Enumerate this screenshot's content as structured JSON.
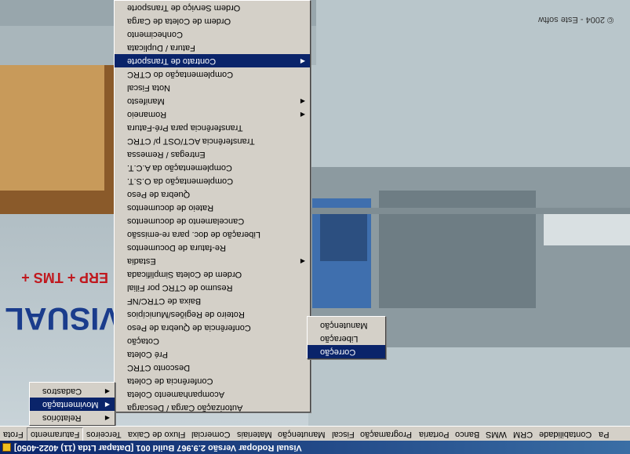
{
  "window": {
    "title": "Visual Rodopar Versão 2.9.967 Build 001 [Datapar Ltda (11) 4022-4050]"
  },
  "background": {
    "copyright": "© 2004 - Este softw",
    "brand_line": "ERP + TMS +",
    "brand_name": "VISUAL"
  },
  "menubar": {
    "items": [
      {
        "label": "Frota",
        "selected": false
      },
      {
        "label": "Faturamento",
        "selected": true
      },
      {
        "label": "Terceiros",
        "selected": false
      },
      {
        "label": "Fluxo de Caixa",
        "selected": false
      },
      {
        "label": "Comercial",
        "selected": false
      },
      {
        "label": "Materiais",
        "selected": false
      },
      {
        "label": "Manutenção",
        "selected": false
      },
      {
        "label": "Fiscal",
        "selected": false
      },
      {
        "label": "Programação",
        "selected": false
      },
      {
        "label": "Portaria",
        "selected": false
      },
      {
        "label": "Banco",
        "selected": false
      },
      {
        "label": "WMS",
        "selected": false
      },
      {
        "label": "CRM",
        "selected": false
      },
      {
        "label": "Contabilidade",
        "selected": false
      },
      {
        "label": "Pa",
        "selected": false
      }
    ]
  },
  "faturamento_menu": {
    "items": [
      {
        "label": "Cadastros",
        "submenu": true,
        "selected": false
      },
      {
        "label": "Movimentação",
        "submenu": true,
        "selected": true
      },
      {
        "label": "Relatórios",
        "submenu": true,
        "selected": false
      }
    ]
  },
  "movimentacao_menu": {
    "items": [
      {
        "label": "Ordem Serviço de Transporte",
        "submenu": false,
        "selected": false
      },
      {
        "label": "Ordem de Coleta de Carga",
        "submenu": false,
        "selected": false
      },
      {
        "label": "Conhecimento",
        "submenu": false,
        "selected": false
      },
      {
        "label": "Fatura / Duplicata",
        "submenu": false,
        "selected": false
      },
      {
        "label": "Contrato de Transporte",
        "submenu": true,
        "selected": true
      },
      {
        "label": "Complementação do CTRC",
        "submenu": false,
        "selected": false
      },
      {
        "label": "Nota Fiscal",
        "submenu": false,
        "selected": false
      },
      {
        "label": "Manifesto",
        "submenu": true,
        "selected": false
      },
      {
        "label": "Romaneio",
        "submenu": true,
        "selected": false
      },
      {
        "label": "Transferência para Pré-Fatura",
        "submenu": false,
        "selected": false
      },
      {
        "label": "Transferência ACT/OST p/ CTRC",
        "submenu": false,
        "selected": false
      },
      {
        "label": "Entregas / Remessa",
        "submenu": false,
        "selected": false
      },
      {
        "label": "Complementação da A.C.T.",
        "submenu": false,
        "selected": false
      },
      {
        "label": "Complementação da O.S.T.",
        "submenu": false,
        "selected": false
      },
      {
        "label": "Quebra de Peso",
        "submenu": false,
        "selected": false
      },
      {
        "label": "Rateio de documentos",
        "submenu": false,
        "selected": false
      },
      {
        "label": "Cancelamento de documentos",
        "submenu": false,
        "selected": false
      },
      {
        "label": "Liberação de doc. para re-emissão",
        "submenu": false,
        "selected": false
      },
      {
        "label": "Re-fatura de Documentos",
        "submenu": false,
        "selected": false
      },
      {
        "label": "Estadia",
        "submenu": true,
        "selected": false
      },
      {
        "label": "Ordem de Coleta Simplificada",
        "submenu": false,
        "selected": false
      },
      {
        "label": "Resumo de CTRC por Filial",
        "submenu": false,
        "selected": false
      },
      {
        "label": "Baixa de CTRC/NF",
        "submenu": false,
        "selected": false
      },
      {
        "label": "Roteiro de Regiões/Municípios",
        "submenu": false,
        "selected": false
      },
      {
        "label": "Conferência de Quebra de Peso",
        "submenu": false,
        "selected": false
      },
      {
        "label": "Cotação",
        "submenu": false,
        "selected": false
      },
      {
        "label": "Pré Coleta",
        "submenu": false,
        "selected": false
      },
      {
        "label": "Desconto CTRC",
        "submenu": false,
        "selected": false
      },
      {
        "label": "Conferência de Coleta",
        "submenu": false,
        "selected": false
      },
      {
        "label": "Acompanhamento Coleta",
        "submenu": false,
        "selected": false
      },
      {
        "label": "Autorização Carga / Descarga",
        "submenu": false,
        "selected": false
      }
    ]
  },
  "contrato_menu": {
    "items": [
      {
        "label": "Manutenção",
        "submenu": false,
        "selected": false
      },
      {
        "label": "Liberação",
        "submenu": false,
        "selected": false
      },
      {
        "label": "Correção",
        "submenu": false,
        "selected": true
      }
    ]
  },
  "colors": {
    "menu_bg": "#d4d0c8",
    "highlight": "#0a246a",
    "title_start": "#0a246a",
    "title_end": "#3a6ea5",
    "brand_red": "#c0181e",
    "brand_blue": "#1a3c8c"
  }
}
